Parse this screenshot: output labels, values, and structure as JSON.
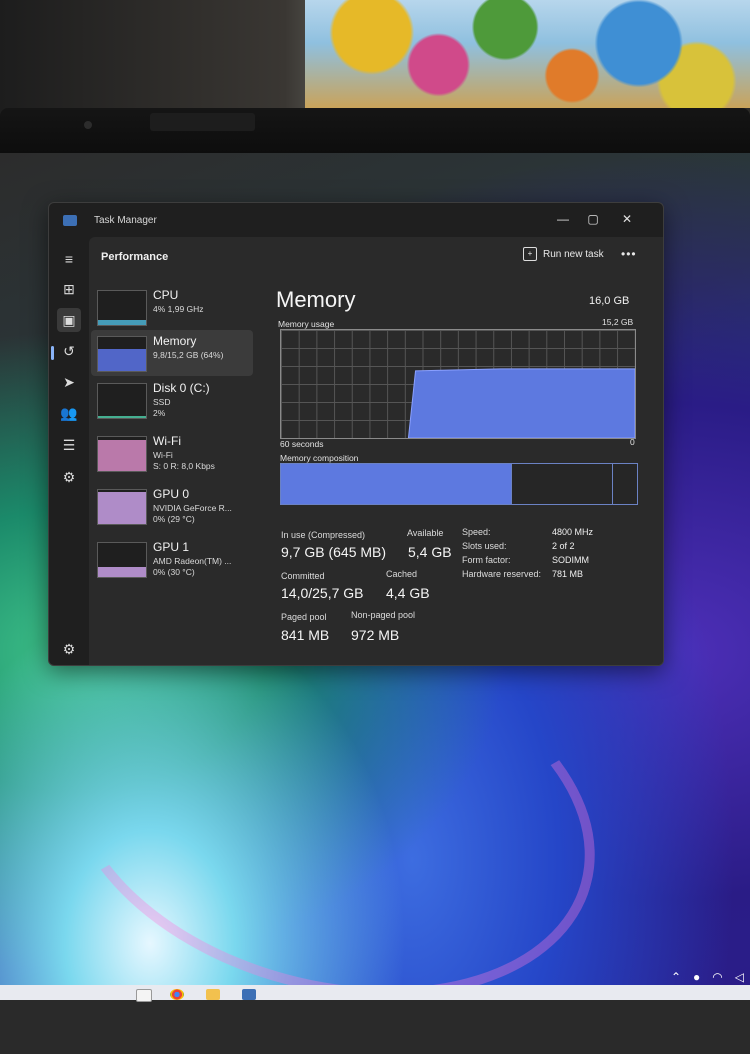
{
  "window": {
    "app_title": "Task Manager",
    "controls": {
      "minimize": "—",
      "maximize": "▢",
      "close": "✕"
    }
  },
  "header": {
    "page_title": "Performance",
    "run_task_label": "Run new task",
    "more_label": "•••"
  },
  "nav": {
    "items": [
      {
        "name": "hamburger-icon",
        "glyph": "≡"
      },
      {
        "name": "processes-icon",
        "glyph": "⊞"
      },
      {
        "name": "performance-icon",
        "glyph": "▣",
        "active": true
      },
      {
        "name": "app-history-icon",
        "glyph": "↺"
      },
      {
        "name": "startup-apps-icon",
        "glyph": "➤"
      },
      {
        "name": "users-icon",
        "glyph": "👥"
      },
      {
        "name": "details-icon",
        "glyph": "☰"
      },
      {
        "name": "services-icon",
        "glyph": "⚙"
      }
    ],
    "settings_glyph": "⚙"
  },
  "devices": [
    {
      "name": "CPU",
      "sub1": "4% 1,99 GHz",
      "sub2": "",
      "fill_color": "#4cb3d4",
      "level": 0.15
    },
    {
      "name": "Memory",
      "sub1": "9,8/15,2 GB (64%)",
      "sub2": "",
      "fill_color": "#5a73e6",
      "level": 0.64,
      "active": true
    },
    {
      "name": "Disk 0 (C:)",
      "sub1": "SSD",
      "sub2": "2%",
      "fill_color": "#4cc9a6",
      "level": 0.05
    },
    {
      "name": "Wi-Fi",
      "sub1": "Wi-Fi",
      "sub2": "S: 0 R: 8,0 Kbps",
      "fill_color": "#d68ac3",
      "level": 0.9
    },
    {
      "name": "GPU 0",
      "sub1": "NVIDIA GeForce R...",
      "sub2": "0% (29 °C)",
      "fill_color": "#c9a0e6",
      "level": 0.95
    },
    {
      "name": "GPU 1",
      "sub1": "AMD Radeon(TM) ...",
      "sub2": "0% (30 °C)",
      "fill_color": "#c9a0e6",
      "level": 0.3
    }
  ],
  "memory": {
    "title": "Memory",
    "total": "16,0 GB",
    "usage_label": "Memory usage",
    "usage_max": "15,2 GB",
    "time_span": "60 seconds",
    "zero": "0",
    "composition_label": "Memory composition",
    "usage_level": 0.64,
    "composition": {
      "in_use": 0.645,
      "modified": 0.005,
      "standby": 0.28,
      "free": 0.07
    },
    "stats": {
      "in_use_label": "In use (Compressed)",
      "in_use_value": "9,7 GB (645 MB)",
      "available_label": "Available",
      "available_value": "5,4 GB",
      "committed_label": "Committed",
      "committed_value": "14,0/25,7 GB",
      "cached_label": "Cached",
      "cached_value": "4,4 GB",
      "paged_label": "Paged pool",
      "paged_value": "841 MB",
      "nonpaged_label": "Non-paged pool",
      "nonpaged_value": "972 MB"
    },
    "specs": [
      {
        "k": "Speed:",
        "v": "4800 MHz"
      },
      {
        "k": "Slots used:",
        "v": "2 of 2"
      },
      {
        "k": "Form factor:",
        "v": "SODIMM"
      },
      {
        "k": "Hardware reserved:",
        "v": "781 MB"
      }
    ]
  },
  "colors": {
    "memory_accent": "#5a73e6",
    "memory_fill": "#5d79e0",
    "window_bg": "#1f1f1f",
    "content_bg": "#2a2a2a"
  }
}
